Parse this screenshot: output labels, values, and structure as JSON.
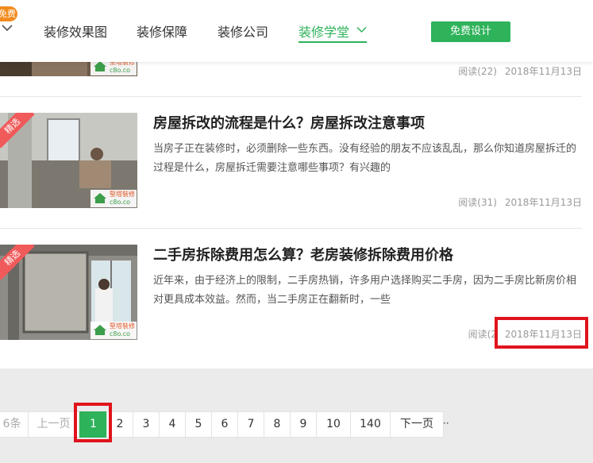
{
  "header": {
    "free_badge": "免费",
    "nav": [
      {
        "label": "装修效果图"
      },
      {
        "label": "装修保障"
      },
      {
        "label": "装修公司"
      },
      {
        "label": "装修学堂",
        "active": true
      }
    ],
    "cta_label": "免费设计",
    "accent_color": "#2eb25a"
  },
  "articles": [
    {
      "title": "",
      "summary": "",
      "reads": "阅读(22)",
      "date": "2018年11月13日",
      "watermark": [
        "堅塔裝修",
        "c8o.co"
      ]
    },
    {
      "tag": "精选",
      "title": "房屋拆改的流程是什么？房屋拆改注意事项",
      "summary": "当房子正在装修时，必须删除一些东西。没有经验的朋友不应该乱乱，那么你知道房屋拆迁的过程是什么，房屋拆迁需要注意哪些事项？有兴趣的",
      "reads": "阅读(31)",
      "date": "2018年11月13日",
      "watermark": [
        "堅塔裝修",
        "c8o.co"
      ]
    },
    {
      "tag": "精选",
      "title": "二手房拆除费用怎么算？老房装修拆除费用价格",
      "summary": "近年来，由于经济上的限制，二手房热销，许多用户选择购买二手房，因为二手房比新房价相对更具成本效益。然而，当二手房正在翻新时，一些",
      "reads": "阅读(2",
      "date": "2018年11月13日",
      "watermark": [
        "堅塔裝修",
        "c8o.co"
      ]
    }
  ],
  "pagination": {
    "total_label": "6条",
    "prev_label": "上一页",
    "pages": [
      "1",
      "2",
      "3",
      "4",
      "5",
      "6",
      "7",
      "8",
      "9",
      "10",
      "140"
    ],
    "current": "1",
    "next_label": "下一页",
    "ellipsis": "··"
  },
  "colors": {
    "highlight": "#e0131c",
    "tag": "#f05a5a"
  }
}
